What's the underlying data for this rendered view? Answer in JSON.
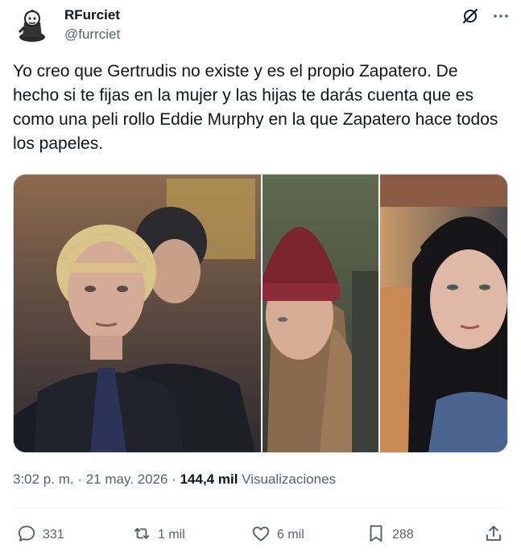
{
  "user": {
    "display_name": "RFurciet",
    "handle": "@furrciet",
    "avatar_icon": "cartoon-character-avatar"
  },
  "header_icons": {
    "grok": "grok-icon",
    "more": "more-dots-icon"
  },
  "tweet": {
    "text": "Yo creo que Gertrudis no existe y es el propio Zapatero. De hecho si te fijas en la mujer y las hijas te darás cuenta que es como una peli rollo Eddie Murphy en la que Zapatero hace todos los papeles."
  },
  "media": {
    "count": 3,
    "images": [
      "woman-portrait",
      "young-woman-beanie",
      "young-woman-dark-hair"
    ]
  },
  "meta": {
    "time": "3:02 p. m.",
    "separator": " · ",
    "date": "21 may. 2026",
    "views_count": "144,4 mil",
    "views_label": "Visualizaciones"
  },
  "actions": {
    "replies": "331",
    "reposts": "1 mil",
    "likes": "6 mil",
    "bookmarks": "288"
  },
  "colors": {
    "text_primary": "#0f1419",
    "text_secondary": "#536471",
    "border": "#cfd9de",
    "divider": "#eff3f4"
  }
}
